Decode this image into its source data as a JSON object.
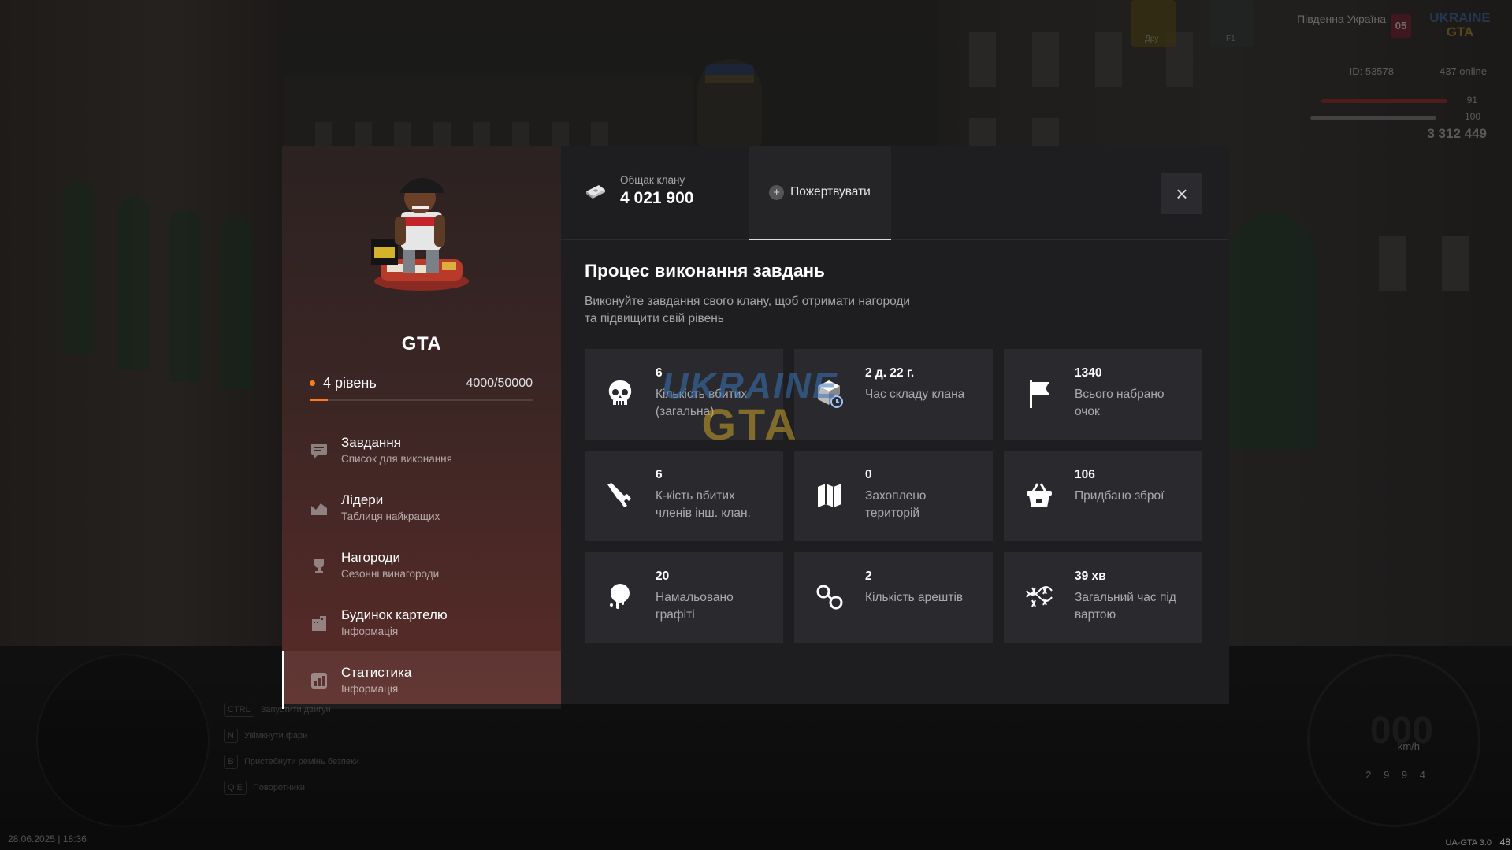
{
  "hud": {
    "region": "Південна Україна",
    "region_badge": "05",
    "logo_top": "UKRAINE",
    "logo_bottom": "GTA",
    "car_tag_1": "Дру",
    "car_tag_2": "F1",
    "player_id": "ID: 53578",
    "online": "437 online",
    "health": "91",
    "armor": "100",
    "money": "3 312 449",
    "keys": [
      {
        "key": "CTRL",
        "label": "Запустити двигун"
      },
      {
        "key": "N",
        "label": "Увімкнути фари"
      },
      {
        "key": "B",
        "label": "Пристебнути ремінь безпеки"
      },
      {
        "key": "Q E",
        "label": "Поворотники"
      }
    ],
    "datetime": "28.06.2025 | 18:36",
    "version": "UA-GTA 3.0",
    "fps": "48",
    "speed": "000",
    "speed_unit": "km/h",
    "odometer": "2 9 9 4"
  },
  "clan": {
    "name": "GTA",
    "level_label": "4 рівень",
    "xp_text": "4000/50000",
    "xp_fraction": 0.08
  },
  "menu": [
    {
      "title": "Завдання",
      "subtitle": "Список для виконання",
      "icon": "chat-icon"
    },
    {
      "title": "Лідери",
      "subtitle": "Таблиця найкращих",
      "icon": "chart-icon"
    },
    {
      "title": "Нагороди",
      "subtitle": "Сезонні винагороди",
      "icon": "trophy-icon"
    },
    {
      "title": "Будинок картелю",
      "subtitle": "Інформація",
      "icon": "building-icon"
    },
    {
      "title": "Статистика",
      "subtitle": "Інформація",
      "icon": "stats-icon"
    }
  ],
  "bank": {
    "label": "Общак клану",
    "value": "4 021 900",
    "donate_label": "Пожертвувати"
  },
  "section": {
    "title": "Процес виконання завдань",
    "description": "Виконуйте завдання свого клану, щоб отримати нагороди та підвищити свій рівень"
  },
  "stats": [
    {
      "value": "6",
      "label": "Кількість вбитих (загальна)",
      "icon": "skull-icon"
    },
    {
      "value": "2 д. 22 г.",
      "label": "Час складу клана",
      "icon": "box-clock-icon"
    },
    {
      "value": "1340",
      "label": "Всього набрано очок",
      "icon": "flag-icon"
    },
    {
      "value": "6",
      "label": "К-кість вбитих членів інш. клан.",
      "icon": "rifle-icon"
    },
    {
      "value": "0",
      "label": "Захоплено територій",
      "icon": "map-icon"
    },
    {
      "value": "106",
      "label": "Придбано зброї",
      "icon": "basket-icon"
    },
    {
      "value": "20",
      "label": "Намальовано графіті",
      "icon": "paint-drip-icon"
    },
    {
      "value": "2",
      "label": "Кількість арештів",
      "icon": "handcuffs-icon"
    },
    {
      "value": "39 хв",
      "label": "Загальний час під вартою",
      "icon": "barbed-wire-icon"
    }
  ],
  "watermark": {
    "top": "UKRAINE",
    "bottom": "GTA"
  },
  "colors": {
    "accent": "#ff7a1a",
    "panel": "#1e1e21",
    "card": "#2a2a2e"
  }
}
